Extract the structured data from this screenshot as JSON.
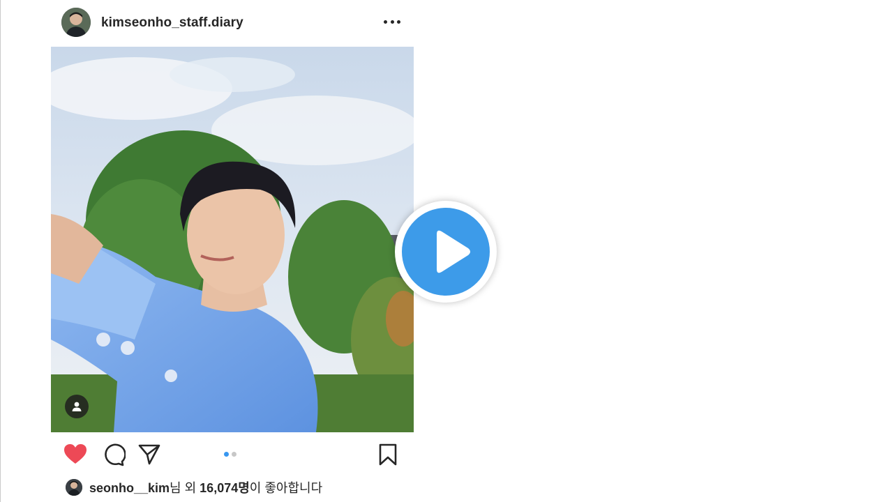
{
  "post": {
    "username": "kimseonho_staff.diary",
    "more_icon": "more-horizontal-icon"
  },
  "media": {
    "type": "photo",
    "carousel_pages": 2,
    "active_page": 1,
    "tag_icon": "user-tag-icon"
  },
  "overlay": {
    "icon": "play-icon",
    "color": "#3d9be9"
  },
  "actions": {
    "like_icon": "heart-filled-icon",
    "like_color": "#ed4956",
    "comment_icon": "comment-icon",
    "share_icon": "send-icon",
    "save_icon": "bookmark-icon"
  },
  "likes": {
    "liker": "seonho__kim",
    "mid": "님 외 ",
    "count": "16,074명",
    "suffix": "이 좋아합니다"
  },
  "colors": {
    "text": "#262626",
    "dot_active": "#3897f0",
    "dot_inactive": "#c7c7c7"
  }
}
